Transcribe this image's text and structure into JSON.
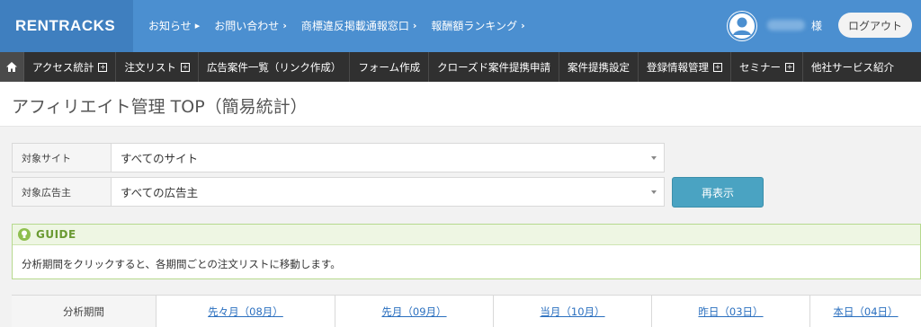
{
  "header": {
    "logo": "RENTRACKS",
    "links": [
      {
        "label": "お知らせ",
        "arrow": "▸"
      },
      {
        "label": "お問い合わせ",
        "arrow": "›"
      },
      {
        "label": "商標違反掲載通報窓口",
        "arrow": "›"
      },
      {
        "label": "報酬額ランキング",
        "arrow": "›"
      }
    ],
    "honorific": "様",
    "logout_label": "ログアウト"
  },
  "nav": {
    "items": [
      {
        "label": "アクセス統計",
        "has_plus": true
      },
      {
        "label": "注文リスト",
        "has_plus": true
      },
      {
        "label": "広告案件一覧（リンク作成）",
        "has_plus": false
      },
      {
        "label": "フォーム作成",
        "has_plus": false
      },
      {
        "label": "クローズド案件提携申請",
        "has_plus": false
      },
      {
        "label": "案件提携設定",
        "has_plus": false
      },
      {
        "label": "登録情報管理",
        "has_plus": true
      },
      {
        "label": "セミナー",
        "has_plus": true
      },
      {
        "label": "他社サービス紹介",
        "has_plus": false
      }
    ]
  },
  "page": {
    "title": "アフィリエイト管理 TOP（簡易統計）"
  },
  "filters": {
    "site_label": "対象サイト",
    "site_value": "すべてのサイト",
    "advertiser_label": "対象広告主",
    "advertiser_value": "すべての広告主",
    "redisplay_label": "再表示"
  },
  "guide": {
    "title": "GUIDE",
    "text": "分析期間をクリックすると、各期間ごとの注文リストに移動します。"
  },
  "period": {
    "header": "分析期間",
    "links": [
      "先々月（08月）",
      "先月（09月）",
      "当月（10月）",
      "昨日（03日）",
      "本日（04日）"
    ]
  },
  "colors": {
    "header_blue": "#4b8fd0",
    "nav_dark": "#303030",
    "button_teal": "#4aa3c2",
    "guide_green": "#8fbf4f",
    "link_blue": "#2a6fbf"
  }
}
